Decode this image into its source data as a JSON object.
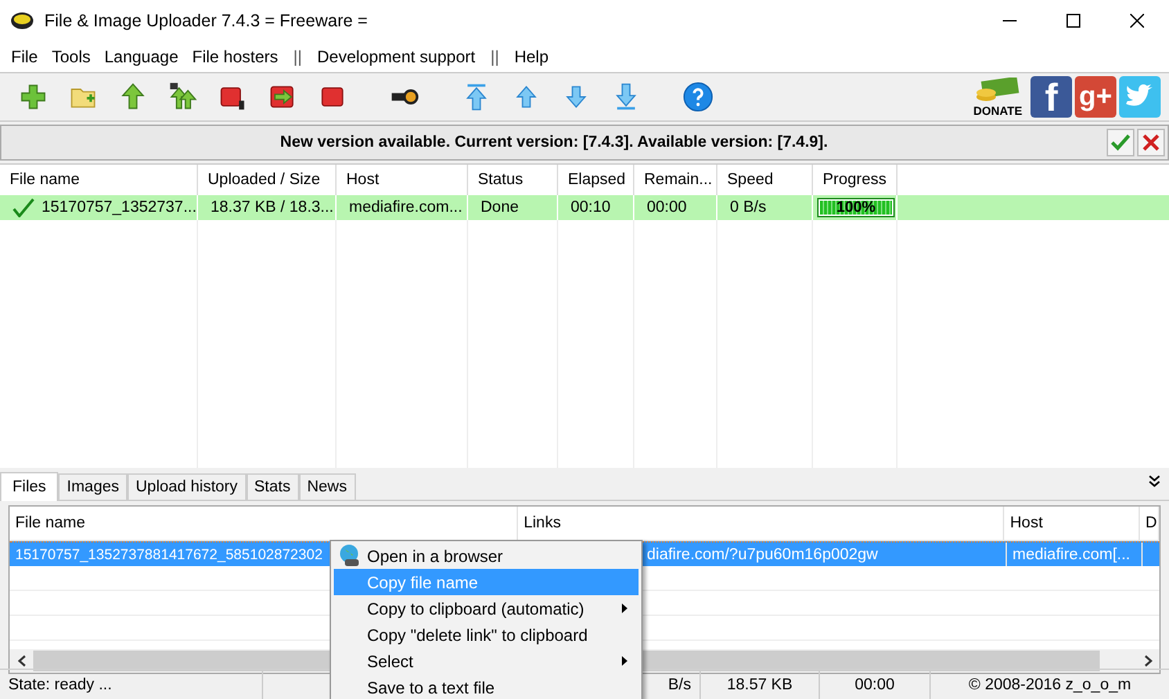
{
  "window": {
    "title": "File & Image Uploader 7.4.3  = Freeware ="
  },
  "menu": [
    {
      "kind": "item",
      "label": "File"
    },
    {
      "kind": "item",
      "label": "Tools"
    },
    {
      "kind": "item",
      "label": "Language"
    },
    {
      "kind": "item",
      "label": "File hosters"
    },
    {
      "kind": "separator",
      "label": "||"
    },
    {
      "kind": "item",
      "label": "Development support"
    },
    {
      "kind": "separator",
      "label": "||"
    },
    {
      "kind": "item",
      "label": "Help"
    }
  ],
  "toolbar": [
    [
      {
        "kind": "add"
      },
      {
        "kind": "folder"
      },
      {
        "kind": "upload"
      },
      {
        "kind": "upload-r"
      },
      {
        "kind": "stop-one"
      },
      {
        "kind": "move"
      },
      {
        "kind": "stop"
      }
    ],
    [
      {
        "kind": "key"
      }
    ],
    [
      {
        "kind": "top"
      },
      {
        "kind": "up"
      },
      {
        "kind": "down"
      },
      {
        "kind": "bottom"
      }
    ],
    [
      {
        "kind": "help"
      }
    ]
  ],
  "social": [
    {
      "kind": "donate",
      "label": "DONATE"
    },
    {
      "kind": "facebook",
      "label": "f"
    },
    {
      "kind": "google",
      "label": "g+"
    },
    {
      "kind": "twitter"
    }
  ],
  "notice": {
    "text": "New version available. Current version: [7.4.3]. Available version: [7.4.9]."
  },
  "uploads": {
    "columns": [
      "File name",
      "Uploaded / Size",
      "Host",
      "Status",
      "Elapsed",
      "Remain...",
      "Speed",
      "Progress"
    ],
    "rows": [
      {
        "done": true,
        "cells": [
          "15170757_1352737...",
          "18.37 KB / 18.3...",
          "mediafire.com...",
          "Done",
          "00:10",
          "00:00",
          "0 B/s"
        ],
        "progress": {
          "level": 1,
          "text": "100%"
        }
      }
    ]
  },
  "tabs": [
    {
      "label": "Files",
      "selected": true
    },
    {
      "label": "Images",
      "selected": false
    },
    {
      "label": "Upload history",
      "selected": false
    },
    {
      "label": "Stats",
      "selected": false
    },
    {
      "label": "News",
      "selected": false
    }
  ],
  "files": {
    "columns": [
      "File name",
      "Links",
      "Host",
      "D"
    ],
    "rows": [
      {
        "selected": true,
        "cells": [
          "15170757_1352737881417672_585102872302",
          "diafire.com/?u7pu60m16p002gw",
          "mediafire.com[..."
        ]
      }
    ]
  },
  "context_menu": [
    {
      "label": "Open in a browser",
      "icon": true,
      "selected": false,
      "submenu": false
    },
    {
      "label": "Copy file name",
      "icon": false,
      "selected": true,
      "submenu": false
    },
    {
      "label": "Copy to clipboard (automatic)",
      "icon": false,
      "selected": false,
      "submenu": true
    },
    {
      "label": "Copy \"delete link\" to clipboard",
      "icon": false,
      "selected": false,
      "submenu": false
    },
    {
      "label": "Select",
      "icon": false,
      "selected": false,
      "submenu": true
    },
    {
      "label": "Save to a text file",
      "icon": false,
      "selected": false,
      "submenu": false
    }
  ],
  "status_bar": [
    "State: ready ...",
    "B/s",
    "18.57 KB",
    "00:00",
    "© 2008-2016 z_o_o_m"
  ]
}
